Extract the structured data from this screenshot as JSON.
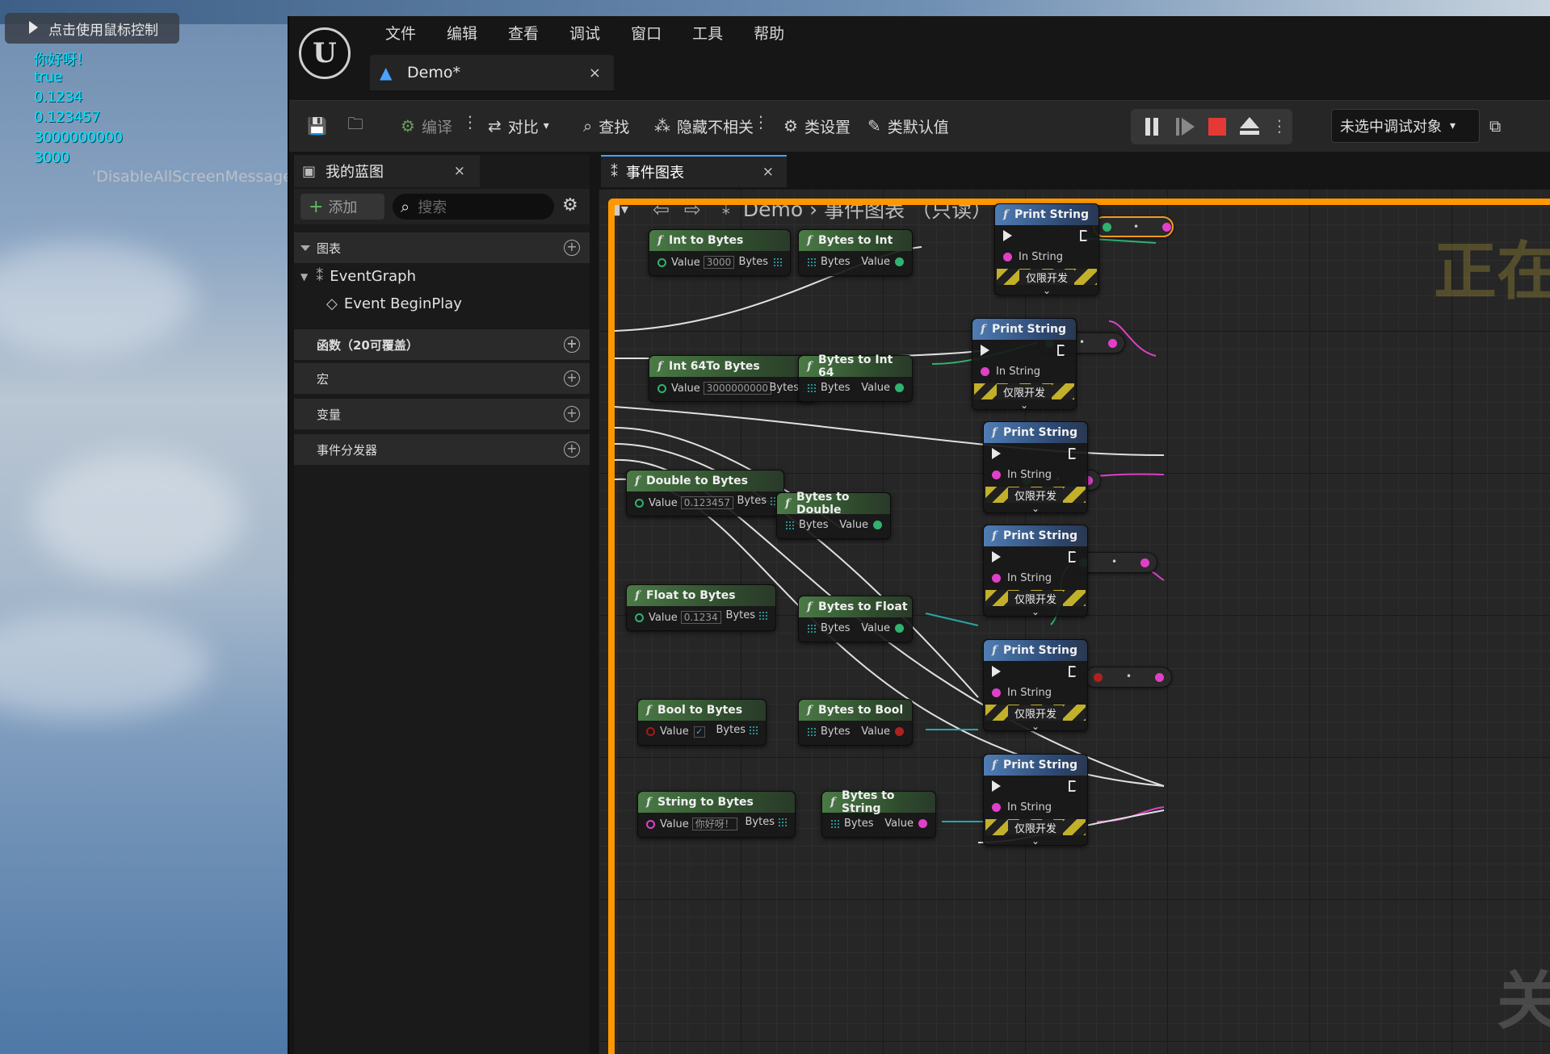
{
  "overlay": {
    "mouse_hint": "点击使用鼠标控制",
    "debug_lines": [
      "你好呀！",
      "true",
      "0.1234",
      "0.123457",
      "3000000000",
      "3000"
    ],
    "debug_gray": "'DisableAllScreenMessages'"
  },
  "menu": [
    "文件",
    "编辑",
    "查看",
    "调试",
    "窗口",
    "工具",
    "帮助"
  ],
  "doc_tab": {
    "title": "Demo*",
    "close": "×"
  },
  "toolbar": {
    "compile": "编译",
    "diff": "对比",
    "find": "查找",
    "hide_unrelated": "隐藏不相关",
    "class_settings": "类设置",
    "class_defaults": "类默认值",
    "debug_object": "未选中调试对象"
  },
  "left_panel": {
    "tab_title": "我的蓝图",
    "add": "添加",
    "search_placeholder": "搜索",
    "sections": {
      "graphs": "图表",
      "functions": "函数（20可覆盖）",
      "macros": "宏",
      "variables": "变量",
      "dispatchers": "事件分发器"
    },
    "tree": [
      "EventGraph",
      "Event BeginPlay"
    ]
  },
  "graph": {
    "tab_title": "事件图表",
    "breadcrumb_root": "Demo",
    "breadcrumb_leaf": "事件图表  （只读）",
    "watermark_top": "正在",
    "watermark_bottom": "关"
  },
  "nodes": {
    "print_string": "Print String",
    "in_string": "In String",
    "dev_only": "仅限开发",
    "value": "Value",
    "bytes": "Bytes",
    "int_to_bytes": "Int to Bytes",
    "bytes_to_int": "Bytes to Int",
    "int64_to_bytes": "Int 64To Bytes",
    "bytes_to_int64": "Bytes to Int 64",
    "double_to_bytes": "Double to Bytes",
    "bytes_to_double": "Bytes to Double",
    "float_to_bytes": "Float to Bytes",
    "bytes_to_float": "Bytes to Float",
    "bool_to_bytes": "Bool to Bytes",
    "bytes_to_bool": "Bytes to Bool",
    "string_to_bytes": "String to Bytes",
    "bytes_to_string": "Bytes to String",
    "int_value": "3000",
    "int64_value": "3000000000",
    "double_value": "0.123457",
    "float_value": "0.1234",
    "string_value": "你好呀！"
  },
  "colors": {
    "frame": "#ff9800",
    "exec": "#e8e8e8",
    "string_pin": "#e040c8",
    "float_pin": "#2fb36f",
    "bool_pin": "#b02020",
    "byte_pin": "#2aa6a6"
  }
}
